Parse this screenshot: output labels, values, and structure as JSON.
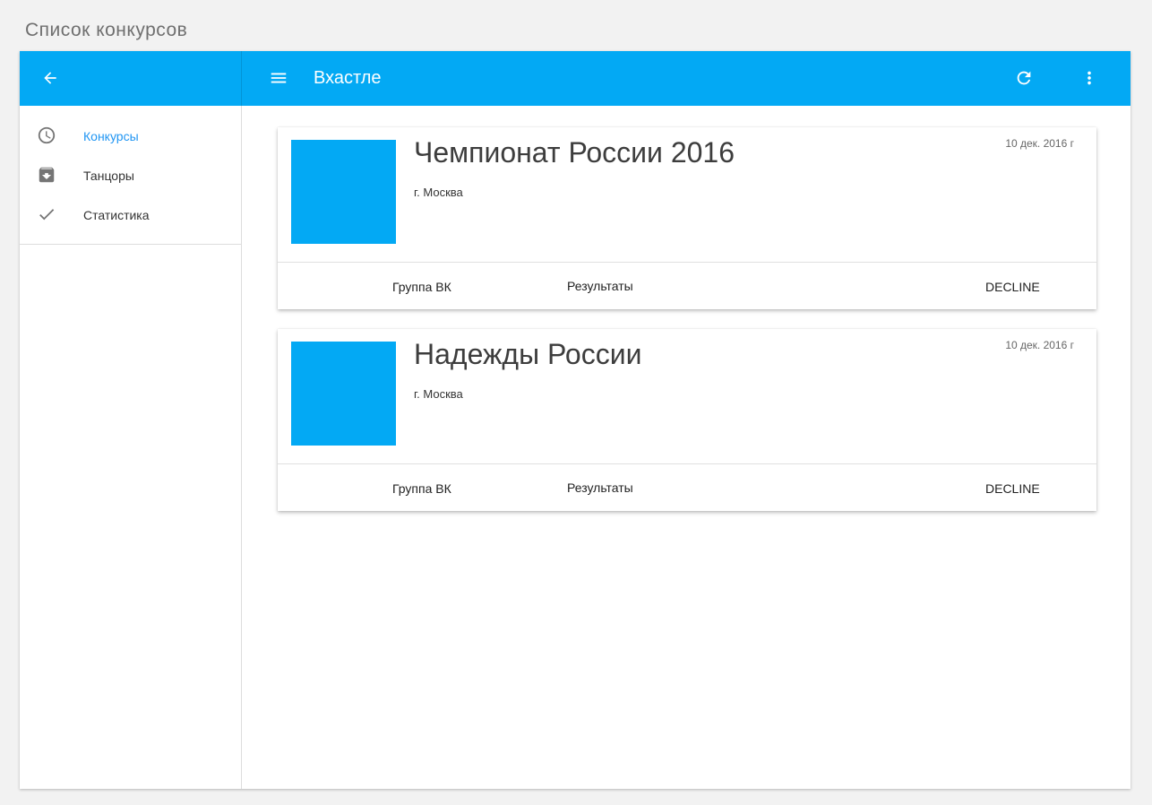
{
  "page": {
    "title": "Список конкурсов"
  },
  "appbar": {
    "title": "Вхастле",
    "back_icon": "arrow-back-icon",
    "menu_icon": "menu-icon",
    "refresh_icon": "refresh-icon",
    "more_icon": "more-vert-icon",
    "color": "#03a9f4"
  },
  "sidebar": {
    "items": [
      {
        "label": "Конкурсы",
        "icon": "clock-icon",
        "active": true
      },
      {
        "label": "Танцоры",
        "icon": "archive-icon",
        "active": false
      },
      {
        "label": "Статистика",
        "icon": "check-icon",
        "active": false
      }
    ],
    "active_color": "#2196f3"
  },
  "cards": [
    {
      "title": "Чемпионат России 2016",
      "city": "г. Москва",
      "date": "10 дек. 2016 г",
      "actions": {
        "vk": "Группа ВК",
        "results": "Результаты",
        "decline": "DECLINE"
      }
    },
    {
      "title": "Надежды России",
      "city": "г. Москва",
      "date": "10 дек. 2016 г",
      "actions": {
        "vk": "Группа ВК",
        "results": "Результаты",
        "decline": "DECLINE"
      }
    }
  ]
}
